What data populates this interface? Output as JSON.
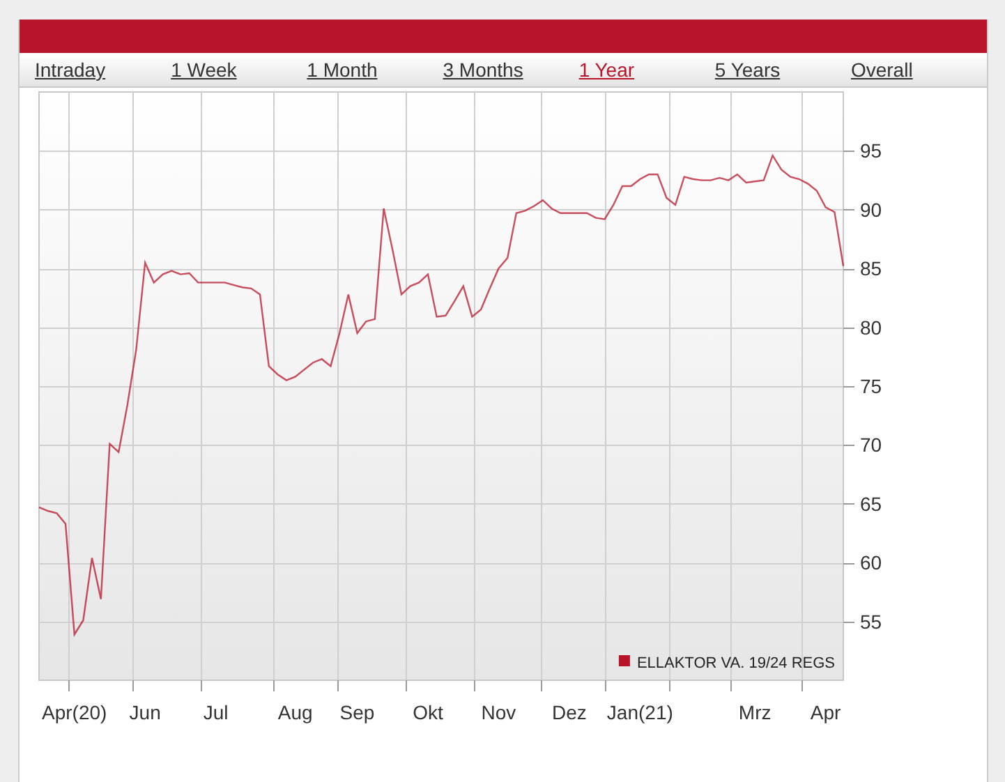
{
  "tabs": [
    {
      "label": "Intraday",
      "selected": false
    },
    {
      "label": "1 Week",
      "selected": false
    },
    {
      "label": "1 Month",
      "selected": false
    },
    {
      "label": "3 Months",
      "selected": false
    },
    {
      "label": "1 Year",
      "selected": true
    },
    {
      "label": "5 Years",
      "selected": false
    },
    {
      "label": "Overall",
      "selected": false
    }
  ],
  "chart": {
    "chart_data": {
      "type": "line",
      "categories": [
        null,
        null,
        null,
        null,
        "Apr(20)",
        null,
        null,
        null,
        null,
        null,
        null,
        null,
        "Jun",
        null,
        null,
        null,
        null,
        null,
        null,
        null,
        "Jul",
        null,
        null,
        null,
        null,
        null,
        null,
        null,
        null,
        "Aug",
        null,
        null,
        null,
        null,
        null,
        null,
        "Sep",
        null,
        null,
        null,
        null,
        null,
        null,
        null,
        "Okt",
        null,
        null,
        null,
        null,
        null,
        null,
        null,
        "Nov",
        null,
        null,
        null,
        null,
        null,
        null,
        null,
        "Dez",
        null,
        null,
        null,
        null,
        null,
        null,
        null,
        "Jan(21)",
        null,
        null,
        null,
        null,
        null,
        null,
        null,
        null,
        null,
        null,
        null,
        null,
        "Mrz",
        null,
        null,
        null,
        null,
        null,
        null,
        null,
        "Apr",
        null,
        null
      ],
      "series": [
        {
          "name": "ELLAKTOR VA. 19/24 REGS",
          "color": "#b81428",
          "values": [
            64.7,
            64.4,
            64.2,
            63.3,
            53.9,
            55.1,
            60.4,
            56.9,
            70.1,
            69.4,
            73.4,
            78.1,
            85.5,
            83.8,
            84.5,
            84.8,
            84.5,
            84.6,
            83.8,
            83.8,
            83.8,
            83.8,
            83.6,
            83.4,
            83.3,
            82.8,
            76.7,
            76.0,
            75.5,
            75.8,
            76.4,
            77.0,
            77.3,
            76.7,
            79.5,
            82.8,
            79.5,
            80.5,
            80.7,
            90.1,
            86.6,
            82.8,
            83.5,
            83.8,
            84.5,
            80.9,
            81.0,
            82.2,
            83.5,
            80.9,
            81.5,
            83.3,
            85.0,
            85.9,
            89.7,
            89.9,
            90.3,
            90.8,
            90.1,
            89.7,
            89.7,
            89.7,
            89.7,
            89.3,
            89.2,
            90.4,
            92.0,
            92.0,
            92.6,
            93.0,
            93.0,
            91.0,
            90.4,
            92.8,
            92.6,
            92.5,
            92.5,
            92.7,
            92.5,
            93.0,
            92.3,
            92.4,
            92.5,
            94.6,
            93.4,
            92.8,
            92.6,
            92.2,
            91.6,
            90.2,
            89.8,
            85.2
          ]
        }
      ],
      "ylim": [
        50,
        100
      ],
      "grid": true,
      "yticks": [
        55,
        60,
        65,
        70,
        75,
        80,
        85,
        90,
        95
      ]
    }
  }
}
